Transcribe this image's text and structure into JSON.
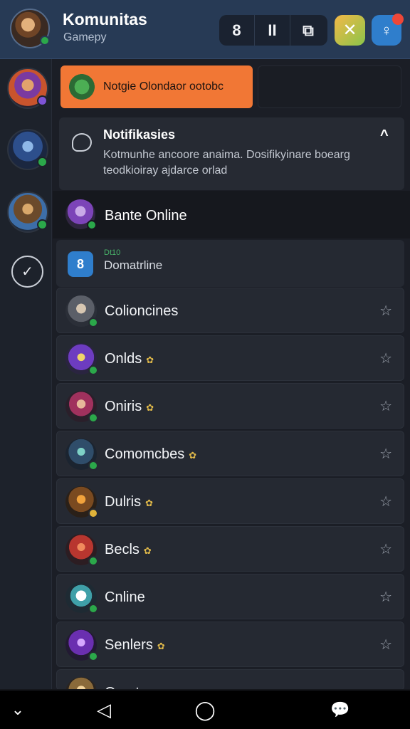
{
  "header": {
    "title": "Komunitas",
    "subtitle": "Gamepy",
    "tools": [
      "8",
      "ΙΙ",
      "⧉"
    ],
    "app_icon": "✕",
    "user_icon": "♀"
  },
  "rail": {
    "check_icon": "✓",
    "avatars": [
      {
        "icon": "hero-avatar-purple",
        "status_color": "#7e54d6"
      },
      {
        "icon": "hero-avatar-blue",
        "status_color": "#2ba84a"
      },
      {
        "icon": "hero-avatar-warrior",
        "status_color": "#2ba84a"
      }
    ]
  },
  "banner": {
    "text": "Notgie Olondaor ootobc"
  },
  "notification": {
    "title": "Notifikasies",
    "body": "Kotmunhe ancoore anaima. Dosifikyinare boearg teodkioiray ajdarce orlad",
    "caret": "^"
  },
  "online_header": {
    "label": "Bante Online"
  },
  "sub_row": {
    "count": "Dt10",
    "label": "Domatrline",
    "icon": "8"
  },
  "members": [
    {
      "name": "Colioncines",
      "emoji": "",
      "status_color": "#2ba84a"
    },
    {
      "name": "Onlds",
      "emoji": "✿",
      "status_color": "#2ba84a"
    },
    {
      "name": "Oniris",
      "emoji": "✿",
      "status_color": "#2ba84a"
    },
    {
      "name": "Comomcbes",
      "emoji": "✿",
      "status_color": "#2ba84a"
    },
    {
      "name": "Dulris",
      "emoji": "✿",
      "status_color": "#e0b33a"
    },
    {
      "name": "Becls",
      "emoji": "✿",
      "status_color": "#2ba84a"
    },
    {
      "name": "Cnline",
      "emoji": "",
      "status_color": "#2ba84a"
    },
    {
      "name": "Senlers",
      "emoji": "✿",
      "status_color": "#2ba84a"
    },
    {
      "name": "Ocrnte",
      "emoji": "✿",
      "status_color": "#2ba84a"
    }
  ],
  "member_action_icon": "☆",
  "navbar": {
    "down": "⌄",
    "back": "◁",
    "home": "◯",
    "chat": "💬"
  },
  "colors": {
    "header_bg": "#273a55",
    "accent_orange": "#f17735",
    "accent_blue": "#2f7ecc",
    "online_green": "#2ba84a",
    "badge_red": "#ef4738"
  }
}
